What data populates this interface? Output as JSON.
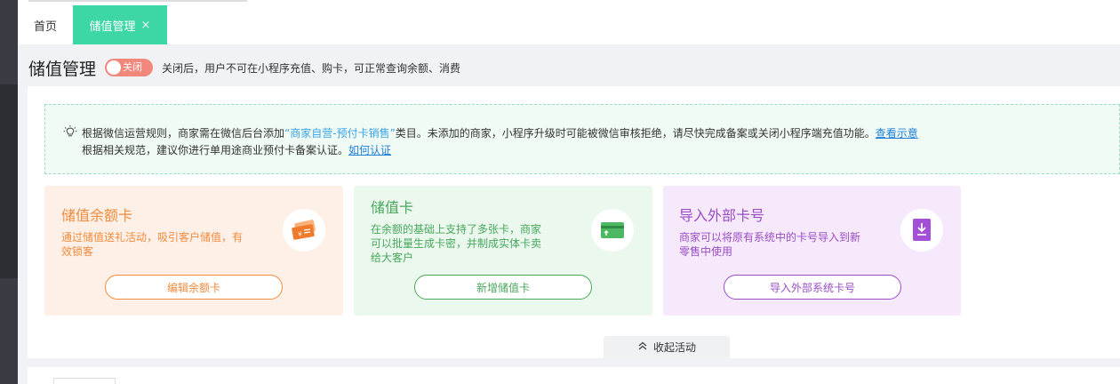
{
  "tabs": [
    {
      "label": "首页"
    },
    {
      "label": "储值管理",
      "close": "×"
    }
  ],
  "header": {
    "title": "储值管理",
    "toggle_label": "关闭",
    "hint": "关闭后，用户不可在小程序充值、购卡，可正常查询余额、消费"
  },
  "notice": {
    "line1_pre": "根据微信运营规则，商家需在微信后台添加",
    "line1_highlight": "“商家自营-预付卡销售”",
    "line1_post": "类目。未添加的商家，小程序升级时可能被微信审核拒绝，请尽快完成备案或关闭小程序端充值功能。",
    "line1_link": "查看示意",
    "line2_text": "根据相关规范，建议你进行单用途商业预付卡备案认证。",
    "line2_link": "如何认证"
  },
  "cards": [
    {
      "title": "储值余额卡",
      "desc": "通过储值送礼活动，吸引客户储值，有效锁客",
      "button": "编辑余额卡",
      "icon": "ticket-icon",
      "accent": "#f28b3d"
    },
    {
      "title": "储值卡",
      "desc": "在余额的基础上支持了多张卡，商家可以批量生成卡密，并制成实体卡卖给大客户",
      "button": "新增储值卡",
      "icon": "card-icon",
      "accent": "#49a75c"
    },
    {
      "title": "导入外部卡号",
      "desc": "商家可以将原有系统中的卡号导入到新零售中使用",
      "button": "导入外部系统卡号",
      "icon": "import-icon",
      "accent": "#9a4dc4"
    }
  ],
  "collapse_label": "收起活动",
  "colors": {
    "brand": "#3dd6a7",
    "toggle_off": "#f2877c"
  }
}
